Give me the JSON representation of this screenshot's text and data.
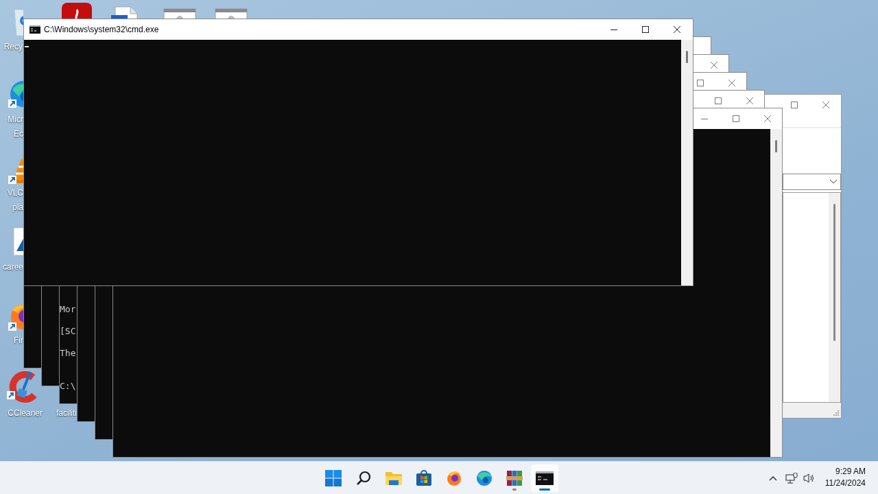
{
  "desktop": {
    "icons": [
      {
        "kind": "recycle-bin",
        "label_lines": [
          "Recy"
        ]
      },
      {
        "kind": "red-app"
      },
      {
        "kind": "document"
      },
      {
        "kind": "generic-window"
      },
      {
        "kind": "generic-window"
      },
      {
        "kind": "edge",
        "label_lines": [
          "Micr",
          "Ec"
        ]
      },
      {
        "kind": "vlc",
        "label_lines": [
          "VLC",
          "pla"
        ]
      },
      {
        "kind": "image",
        "label_lines": [
          "caree"
        ]
      },
      {
        "kind": "firefox",
        "label_lines": [
          "Fir"
        ]
      },
      {
        "kind": "ccleaner",
        "label_lines": [
          "CCleaner"
        ]
      },
      {
        "kind": "hidden",
        "label_lines": [
          "faciliti"
        ]
      }
    ]
  },
  "dialog_window": {
    "kind": "dialog"
  },
  "background_windows": [
    {
      "kind": "console"
    },
    {
      "kind": "console"
    },
    {
      "kind": "console",
      "lines": [
        "Mor",
        "[SC",
        "The",
        "C:\\"
      ]
    },
    {
      "kind": "console"
    },
    {
      "kind": "console"
    },
    {
      "kind": "console"
    }
  ],
  "main_window": {
    "title": "C:\\Windows\\system32\\cmd.exe"
  },
  "taskbar": {
    "apps": [
      {
        "kind": "start",
        "running": false,
        "active": false
      },
      {
        "kind": "search",
        "running": false,
        "active": false
      },
      {
        "kind": "explorer",
        "running": false,
        "active": false
      },
      {
        "kind": "store",
        "running": false,
        "active": false
      },
      {
        "kind": "firefox",
        "running": false,
        "active": false
      },
      {
        "kind": "edge",
        "running": false,
        "active": false
      },
      {
        "kind": "archiver",
        "running": true,
        "active": false
      },
      {
        "kind": "terminal",
        "running": true,
        "active": true
      }
    ],
    "clock": {
      "time": "9:29 AM",
      "date": "11/24/2024"
    }
  }
}
